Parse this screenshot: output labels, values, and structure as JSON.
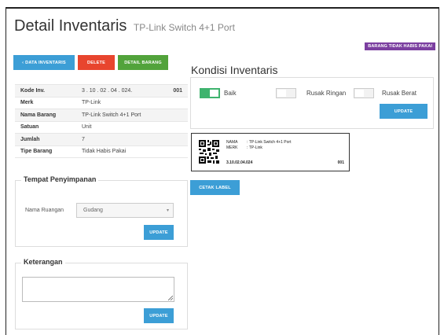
{
  "header": {
    "title": "Detail Inventaris",
    "subtitle": "TP-Link Switch 4+1 Port",
    "badge": "BARANG TIDAK HABIS PAKAI"
  },
  "actions": {
    "back_label": "DATA INVENTARIS",
    "delete_label": "DELETE",
    "detail_label": "DETAIL BARANG"
  },
  "info": {
    "rows": [
      {
        "label": "Kode Inv.",
        "value": "3 . 10 . 02 . 04 . 024.",
        "extra": "001"
      },
      {
        "label": "Merk",
        "value": "TP-Link"
      },
      {
        "label": "Nama Barang",
        "value": "TP-Link Switch 4+1 Port"
      },
      {
        "label": "Satuan",
        "value": "Unit"
      },
      {
        "label": "Jumlah",
        "value": "7"
      },
      {
        "label": "Tipe Barang",
        "value": "Tidak Habis Pakai"
      }
    ]
  },
  "storage": {
    "legend": "Tempat Penyimpanan",
    "field_label": "Nama Ruangan",
    "selected": "Gudang",
    "update_label": "UPDATE"
  },
  "notes": {
    "legend": "Keterangan",
    "value": "",
    "update_label": "UPDATE"
  },
  "condition": {
    "title": "Kondisi Inventaris",
    "options": [
      {
        "label": "Baik",
        "on": true
      },
      {
        "label": "Rusak Ringan",
        "on": false
      },
      {
        "label": "Rusak Berat",
        "on": false
      }
    ],
    "update_label": "UPDATE"
  },
  "label_card": {
    "nama_key": "NAMA",
    "nama_value": ":   TP-Link Switch 4+1 Port",
    "merk_key": "MERK",
    "merk_value": ":   TP-Link",
    "code": "3.10.02.04.024",
    "number": "001"
  },
  "print_label": "CETAK LABEL",
  "colors": {
    "blue": "#3c9ed6",
    "red": "#e8452e",
    "green": "#52a33b",
    "purple": "#7b3fa0",
    "toggle_on": "#3fb36e"
  }
}
